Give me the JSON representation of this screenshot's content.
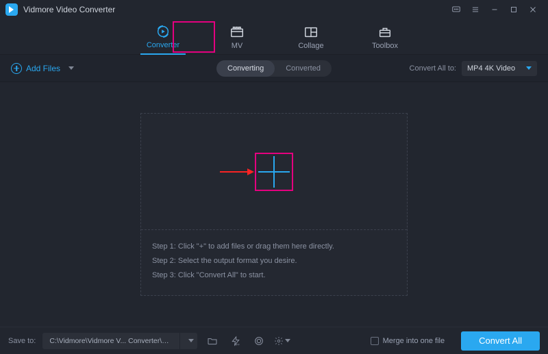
{
  "app": {
    "title": "Vidmore Video Converter"
  },
  "top_tabs": {
    "converter": "Converter",
    "mv": "MV",
    "collage": "Collage",
    "toolbox": "Toolbox"
  },
  "toolbar": {
    "add_files": "Add Files",
    "sub_tab_converting": "Converting",
    "sub_tab_converted": "Converted",
    "convert_all_to_label": "Convert All to:",
    "format_selected": "MP4 4K Video"
  },
  "drop": {
    "step1": "Step 1: Click \"+\" to add files or drag them here directly.",
    "step2": "Step 2: Select the output format you desire.",
    "step3": "Step 3: Click \"Convert All\" to start."
  },
  "bottom": {
    "save_to_label": "Save to:",
    "path": "C:\\Vidmore\\Vidmore V... Converter\\Converted",
    "merge_label": "Merge into one file",
    "convert_all_btn": "Convert All"
  },
  "colors": {
    "accent": "#2aa8f0",
    "highlight": "#e4007f"
  }
}
